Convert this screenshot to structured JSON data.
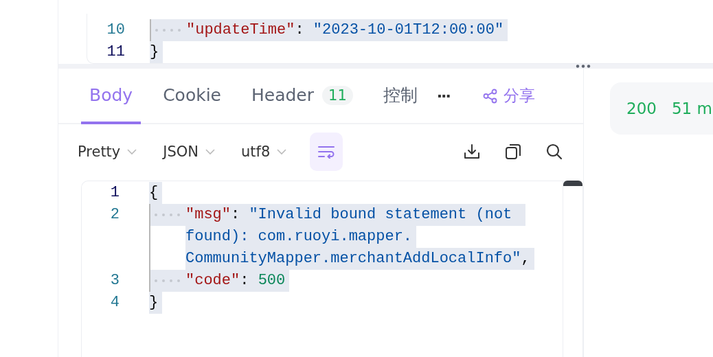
{
  "top_editor": {
    "lines": [
      {
        "number": "10",
        "active": false,
        "rows": [
          {
            "indent": true,
            "tokens": [
              {
                "kind": "key",
                "text": "\"updateTime\""
              },
              {
                "kind": "punct",
                "text": ": "
              },
              {
                "kind": "string",
                "text": "\"2023-10-01T12:00:00\""
              }
            ]
          }
        ]
      },
      {
        "number": "11",
        "active": true,
        "rows": [
          {
            "indent": false,
            "tokens": [
              {
                "kind": "punct",
                "text": "}"
              }
            ]
          }
        ]
      }
    ]
  },
  "tabs": [
    {
      "label": "Body",
      "selected": true
    },
    {
      "label": "Cookie",
      "selected": false
    },
    {
      "label": "Header",
      "selected": false,
      "badge": "11"
    },
    {
      "label": "控制",
      "selected": false
    }
  ],
  "more_button": "···",
  "share_button": {
    "label": "分享"
  },
  "toolbar": {
    "dropdowns": [
      "Pretty",
      "JSON",
      "utf8"
    ],
    "wrap": {
      "on": true
    }
  },
  "response_editor": {
    "lines": [
      {
        "number": "1",
        "active": true,
        "rows": [
          {
            "indent": false,
            "tokens": [
              {
                "kind": "punct",
                "text": "{"
              }
            ]
          }
        ]
      },
      {
        "number": "2",
        "active": false,
        "rows": [
          {
            "indent": true,
            "tokens": [
              {
                "kind": "key",
                "text": "\"msg\""
              },
              {
                "kind": "punct",
                "text": ": "
              },
              {
                "kind": "string",
                "text": "\"Invalid bound statement (not "
              }
            ]
          },
          {
            "indent": false,
            "tokens": [
              {
                "kind": "string",
                "text": "found): com.ruoyi.mapper."
              }
            ]
          },
          {
            "indent": false,
            "tokens": [
              {
                "kind": "string",
                "text": "CommunityMapper.merchantAddLocalInfo\""
              },
              {
                "kind": "punct",
                "text": ","
              }
            ]
          }
        ]
      },
      {
        "number": "3",
        "active": false,
        "rows": [
          {
            "indent": true,
            "tokens": [
              {
                "kind": "key",
                "text": "\"code\""
              },
              {
                "kind": "punct",
                "text": ": "
              },
              {
                "kind": "number",
                "text": "500"
              }
            ]
          }
        ]
      },
      {
        "number": "4",
        "active": false,
        "rows": [
          {
            "indent": false,
            "tokens": [
              {
                "kind": "punct",
                "text": "}"
              }
            ]
          }
        ]
      }
    ]
  },
  "status": {
    "code": "200",
    "time": "51 m"
  }
}
